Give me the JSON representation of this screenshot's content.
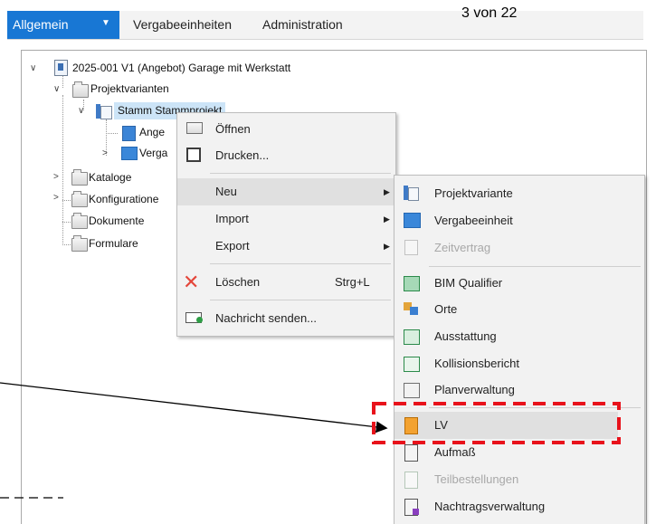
{
  "page_counter": "3 von 22",
  "tabs": {
    "active": "Allgemein",
    "items": [
      "Vergabeeinheiten",
      "Administration"
    ]
  },
  "tree": {
    "root": "2025-001 V1 (Angebot) Garage mit Werkstatt",
    "projektvarianten": "Projektvarianten",
    "stamm": "Stamm Stammprojekt",
    "angebot": "Ange",
    "vergabe": "Verga",
    "kataloge": "Kataloge",
    "konfigurationen": "Konfiguratione",
    "dokumente": "Dokumente",
    "formulare": "Formulare"
  },
  "context_menu": {
    "open": "Öffnen",
    "print": "Drucken...",
    "new": "Neu",
    "import": "Import",
    "export": "Export",
    "delete": "Löschen",
    "delete_shortcut": "Strg+L",
    "send_message": "Nachricht senden..."
  },
  "submenu": {
    "projektvariante": "Projektvariante",
    "vergabeeinheit": "Vergabeeinheit",
    "zeitvertrag": "Zeitvertrag",
    "bim_qualifier": "BIM Qualifier",
    "orte": "Orte",
    "ausstattung": "Ausstattung",
    "kollisionsbericht": "Kollisionsbericht",
    "planverwaltung": "Planverwaltung",
    "lv": "LV",
    "aufmass": "Aufmaß",
    "teilbestellungen": "Teilbestellungen",
    "nachtragsverwaltung": "Nachtragsverwaltung"
  },
  "colors": {
    "accent": "#1877d4",
    "highlight_dash": "#e8121b",
    "selection": "#cce4f7"
  }
}
